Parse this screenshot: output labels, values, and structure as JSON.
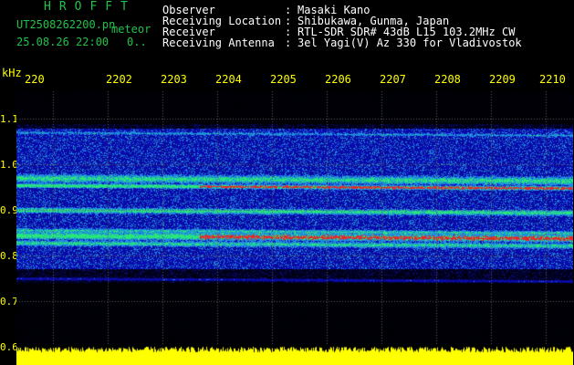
{
  "header": {
    "app_title": "HROFFT",
    "filename": "UT2508262200.pn",
    "mode_label": "meteor",
    "datetime": "25.08.26 22:00",
    "count": "0.."
  },
  "info": {
    "rows": [
      {
        "label": "Observer",
        "colon": ":",
        "value": "Masaki Kano"
      },
      {
        "label": "Receiving Location",
        "colon": ":",
        "value": "Shibukawa, Gunma, Japan"
      },
      {
        "label": "Receiver",
        "colon": ":",
        "value": "RTL-SDR SDR# 43dB L15 103.2MHz CW"
      },
      {
        "label": "Receiving Antenna",
        "colon": ":",
        "value": "3el Yagi(V) Az 330 for Vladivostok"
      }
    ]
  },
  "axis": {
    "unit_label": "kHz",
    "time_ticks": [
      "220",
      "2202",
      "2203",
      "2204",
      "2205",
      "2206",
      "2207",
      "2208",
      "2209",
      "2210"
    ],
    "freq_ticks": [
      "1.1",
      "1.0",
      "0.9",
      "0.8",
      "0.7",
      "0.6"
    ]
  },
  "colors": {
    "background": "#000000",
    "title_green": "#22c24a",
    "axis_yellow": "#ffff00",
    "grid_dot": "#5a5a5a",
    "strip_yellow": "#ffff00"
  }
}
